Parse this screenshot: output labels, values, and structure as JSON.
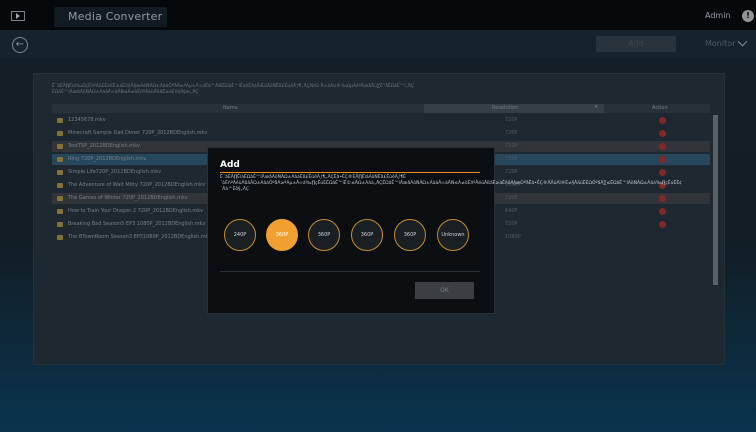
{
  "app": {
    "title": "Media Converter",
    "user": "Admin",
    "user_icon_char": "!"
  },
  "toolbar": {
    "back_icon": "arrow-left-circle-icon",
    "add_label": "Add",
    "filter_value": "Monitor"
  },
  "panel": {
    "notes_line1": "Ë´ãÈÅ∏Êìá‰ΩçÊñºÁõ£ÊéßË≥áÊñôÂ§æÁöÑÂΩ±ÁâáÔºåÁ≥ªÁµ±Â∞áËá™ÂãïËΩâÊ™îÊàêÊåáÂÆöÁöÑËß£ÊûêÂ∫¶„ÄÇNAS Â∞áÂú®‰ΩµÁôºÂæåÂü∑Ë°åËΩâÊ™î„ÄÇ",
    "notes_line2": "ËΩâÊ™îÂæåÁöÑÂΩ±ÁâáÂ∞áÂÑ≤Â≠òÊñºÂéüÂßãË≥áÊñôÂ§æ„ÄÇ",
    "columns": {
      "name": "Name",
      "resolution": "Resolution",
      "sort_icon": "▾",
      "action": "Action"
    },
    "rows": [
      {
        "name": "12345678.mkv",
        "resolution": "720P"
      },
      {
        "name": "Minecraft Sample Dad Dimer 720P_2012BDEnglish.mkv",
        "resolution": "720P"
      },
      {
        "name": "TestTSP_2012BDEnglish.mkv",
        "resolution": "720P"
      },
      {
        "name": "Ring 720P_2012BDEnglish.mkv",
        "resolution": "720P"
      },
      {
        "name": "Simple Life720P_2012BDEnglish.mkv",
        "resolution": "720P"
      },
      {
        "name": "The Adventure of Walt Mitty 720P_2012BDEnglish.mkv",
        "resolution": "1080P"
      },
      {
        "name": "The Games of Winter 720P_2012BDEnglish.mkv",
        "resolution": "720P"
      },
      {
        "name": "How to Train Your Dragon 2 720P_2012BDEnglish.mkv",
        "resolution": "640P"
      },
      {
        "name": "Breaking Bad Season5 EP3 1080P_2012BDEnglish.mkv",
        "resolution": "720P"
      },
      {
        "name": "The BTownRoom Season3 EP31080P_2012BDEnglish.mkv",
        "resolution": "1080P"
      }
    ]
  },
  "modal": {
    "title": "Add",
    "description": "Ë´ãÈÅ∏ÊìáËΩâÊ™îÂæåÁöÑÂΩ±ÁâáËß£ÊûêÂ∫¶„ÄÇËã•ÊÇ®ÈÅ∏ÊìáÁöÑËß£ÊûêÂ∫¶È´òÊñºÂéüÂßãÂΩ±ÁâáÔºåÁ≥ªÁµ±Â∞á‰∏çÊúÉËΩâÊ™îË©≤ÂΩ±Áâá„ÄÇËΩâÊ™îÂæåÁöÑÂΩ±ÁâáÂ∞áÂÑ≤Â≠òÊñºÂéüÂßãË≥áÊñôÂ§æÔºåËã•ÊÇ®ÂÅúÁî®Ê≠§ÂäüËÉΩÔºåÂ∑≤ËΩâÊ™îÁöÑÂΩ±Áâá‰∏çÊúÉË¢´Âà™Èô§„ÄÇ",
    "options": [
      "240P",
      "360P",
      "360P",
      "360P",
      "360P",
      "Unknown"
    ],
    "selected_index": 1,
    "ok_label": "OK"
  },
  "colors": {
    "accent": "#f0a030",
    "selected_row": "#3b6e8e",
    "delete_action": "#d23b3b"
  }
}
